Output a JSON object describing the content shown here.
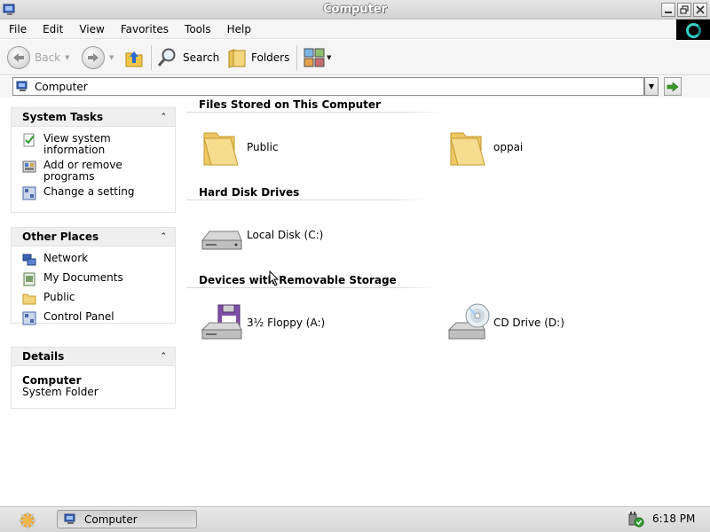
{
  "window": {
    "title": "Computer"
  },
  "menu": [
    "File",
    "Edit",
    "View",
    "Favorites",
    "Tools",
    "Help"
  ],
  "toolbar": {
    "back_label": "Back",
    "search_label": "Search",
    "folders_label": "Folders"
  },
  "address": {
    "value": "Computer"
  },
  "sidebar": {
    "system_tasks": {
      "title": "System Tasks",
      "items": [
        {
          "label": "View system information",
          "icon": "check-doc-icon"
        },
        {
          "label": "Add or remove programs",
          "icon": "programs-icon"
        },
        {
          "label": "Change a setting",
          "icon": "control-panel-icon"
        }
      ]
    },
    "other_places": {
      "title": "Other Places",
      "items": [
        {
          "label": "Network",
          "icon": "network-icon"
        },
        {
          "label": "My Documents",
          "icon": "documents-icon"
        },
        {
          "label": "Public",
          "icon": "folder-icon"
        },
        {
          "label": "Control Panel",
          "icon": "control-panel-icon"
        }
      ]
    },
    "details": {
      "title": "Details",
      "name": "Computer",
      "type": "System Folder"
    }
  },
  "groups": [
    {
      "title": "Files Stored on This Computer",
      "items": [
        {
          "label": "Public",
          "icon": "folder-icon"
        },
        {
          "label": "oppai",
          "icon": "folder-icon"
        }
      ]
    },
    {
      "title": "Hard Disk Drives",
      "items": [
        {
          "label": "Local Disk (C:)",
          "icon": "hard-disk-icon"
        }
      ]
    },
    {
      "title": "Devices with Removable Storage",
      "items": [
        {
          "label": "3½ Floppy (A:)",
          "icon": "floppy-drive-icon"
        },
        {
          "label": "CD Drive (D:)",
          "icon": "cd-drive-icon"
        }
      ]
    }
  ],
  "taskbar": {
    "task_label": "Computer",
    "clock": "6:18 PM"
  },
  "colors": {
    "accent_green": "#3a9a2a",
    "folder": "#f2d47a",
    "taskbar": "#dcdcdc"
  }
}
